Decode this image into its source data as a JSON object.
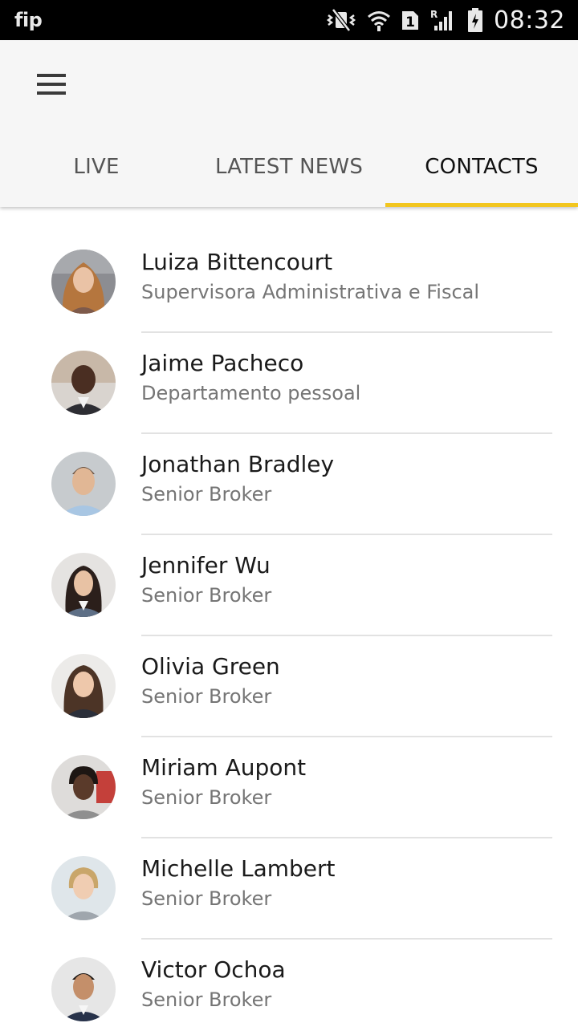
{
  "status_bar": {
    "carrier": "fip",
    "time": "08:32",
    "icons": [
      "vibrate-mute-icon",
      "wifi-icon",
      "sim-1-icon",
      "signal-roaming-icon",
      "battery-charging-icon"
    ]
  },
  "app_bar": {
    "menu_icon": "hamburger-menu-icon",
    "tabs": [
      {
        "label": "LIVE",
        "active": false
      },
      {
        "label": "LATEST NEWS",
        "active": false
      },
      {
        "label": "CONTACTS",
        "active": true
      }
    ],
    "accent_color": "#f2c61f"
  },
  "contacts": [
    {
      "name": "Luiza Bittencourt",
      "role": "Supervisora Administrativa e Fiscal"
    },
    {
      "name": "Jaime Pacheco",
      "role": "Departamento pessoal"
    },
    {
      "name": "Jonathan Bradley",
      "role": "Senior Broker"
    },
    {
      "name": "Jennifer Wu",
      "role": "Senior Broker"
    },
    {
      "name": "Olivia Green",
      "role": "Senior Broker"
    },
    {
      "name": "Miriam Aupont",
      "role": "Senior Broker"
    },
    {
      "name": "Michelle Lambert",
      "role": "Senior Broker"
    },
    {
      "name": "Victor Ochoa",
      "role": "Senior Broker"
    }
  ]
}
